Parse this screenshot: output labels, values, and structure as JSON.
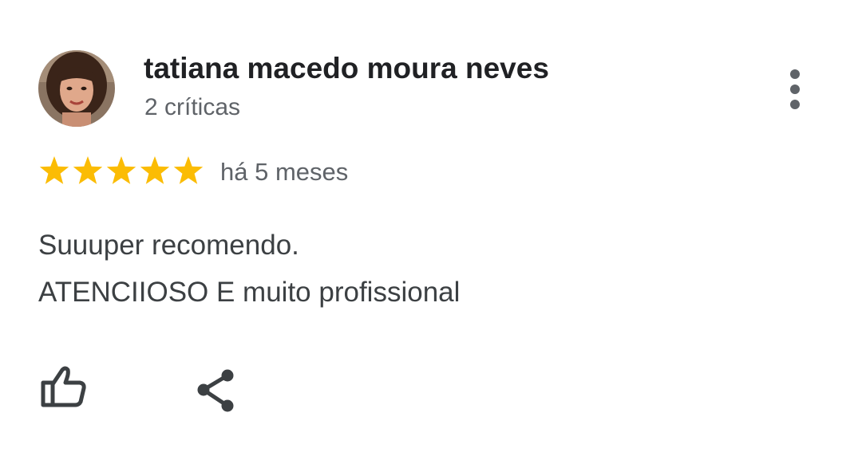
{
  "review": {
    "reviewer_name": "tatiana macedo moura neves",
    "review_count": "2 críticas",
    "rating": 5,
    "rating_max": 5,
    "date": "há 5 meses",
    "text_lines": [
      "Suuuper recomendo.",
      "ATENCIIOSO E muito profissional"
    ]
  },
  "icons": {
    "avatar": "profile-photo",
    "more": "vertical-ellipsis-icon",
    "star": "star-icon",
    "like": "thumbs-up-icon",
    "share": "share-icon"
  },
  "colors": {
    "star": "#fbbc04",
    "name": "#202124",
    "secondary_text": "#5f6368",
    "body_text": "#3c4043",
    "icon": "#3c4043"
  }
}
